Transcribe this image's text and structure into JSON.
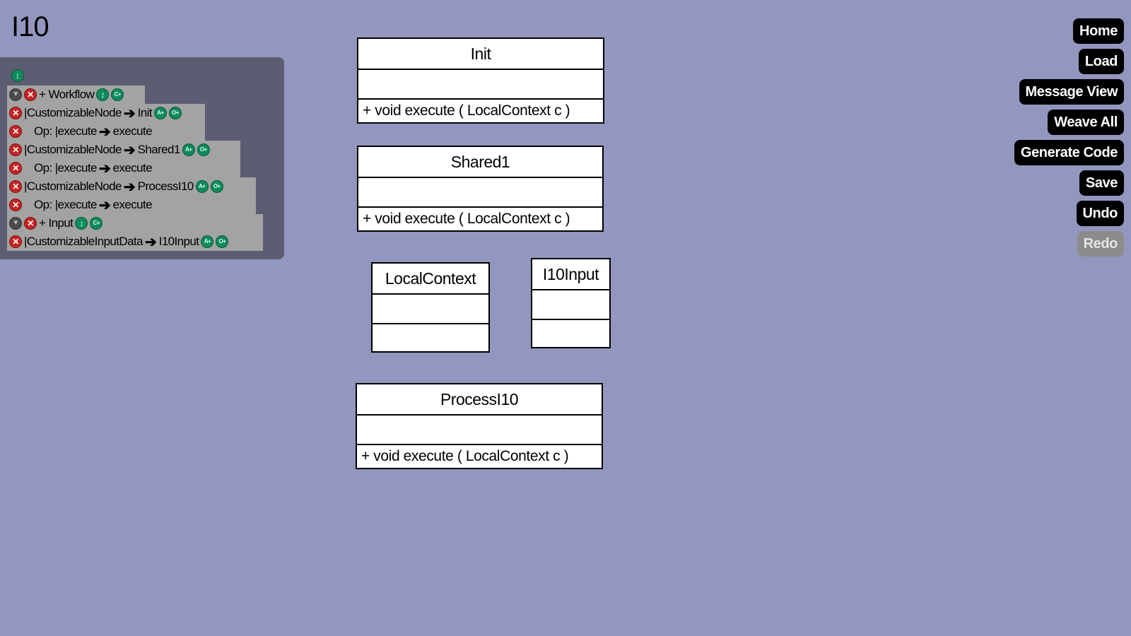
{
  "page": {
    "title": "I10"
  },
  "tree": {
    "rows": [
      {
        "kind": "group",
        "label": "+ Workflow"
      },
      {
        "kind": "node",
        "source": "|CustomizableNode",
        "target": "Init"
      },
      {
        "kind": "op",
        "source": "Op: |execute",
        "target": "execute"
      },
      {
        "kind": "node",
        "source": "|CustomizableNode",
        "target": "Shared1"
      },
      {
        "kind": "op",
        "source": "Op: |execute",
        "target": "execute"
      },
      {
        "kind": "node",
        "source": "|CustomizableNode",
        "target": "ProcessI10"
      },
      {
        "kind": "op",
        "source": "Op: |execute",
        "target": "execute"
      },
      {
        "kind": "group",
        "label": "+ Input"
      },
      {
        "kind": "node",
        "source": "|CustomizableInputData",
        "target": "I10Input"
      }
    ],
    "icons": {
      "toggle": "▼",
      "delete": "✕",
      "move": "↕",
      "add_child": "C+",
      "add_attr": "A+",
      "add_op": "O+",
      "arrow": "➔"
    }
  },
  "toolbar": {
    "home": "Home",
    "load": "Load",
    "message_view": "Message View",
    "weave_all": "Weave All",
    "generate_code": "Generate Code",
    "save": "Save",
    "undo": "Undo",
    "redo": "Redo"
  },
  "classes": {
    "init": {
      "name": "Init",
      "op": "+ void  execute ( LocalContext  c )"
    },
    "shared1": {
      "name": "Shared1",
      "op": "+ void  execute ( LocalContext  c )"
    },
    "localcontext": {
      "name": "LocalContext"
    },
    "i10input": {
      "name": "I10Input"
    },
    "processi10": {
      "name": "ProcessI10",
      "op": "+ void  execute ( LocalContext  c )"
    }
  },
  "colors": {
    "background": "#9397bf",
    "panel": "#5c5d72",
    "tree_row": "#a3a3a3",
    "delete_icon": "#c62424",
    "action_icon": "#0f8a5c",
    "button": "#000000",
    "button_disabled": "#8c8c8c"
  }
}
